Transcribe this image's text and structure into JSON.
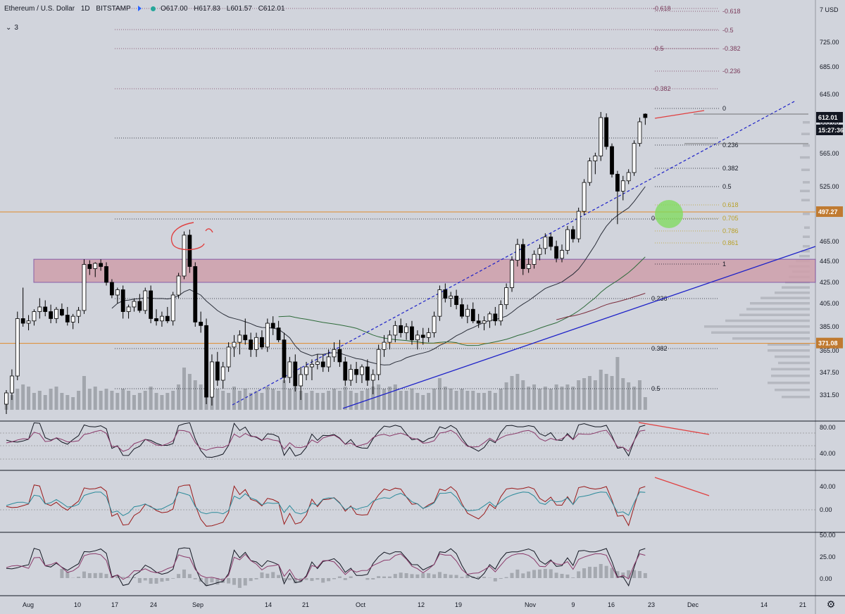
{
  "header": {
    "symbol": "Ethereum / U.S. Dollar",
    "interval": "1D",
    "exchange": "BITSTAMP",
    "open": "O617.00",
    "high": "H617.83",
    "low": "L601.57",
    "close": "C612.01",
    "indicator_count": "3"
  },
  "colors": {
    "background": "#d1d4dc",
    "up_candle": "#ffffff",
    "down_candle": "#000000",
    "trend_blue": "#1e22c8",
    "horizontal_orange": "#e08a2a",
    "resistance_zone": "#cfa0ab",
    "fib": "#7a3a5a",
    "fib_yellow": "#b8a028",
    "divergence_red": "#e04040",
    "price_badge": "#131722",
    "level_badge": "#c07a30",
    "highlight_green": "#7cdc5a"
  },
  "chart_data": {
    "type": "candlestick",
    "title": "Ethereum / U.S. Dollar 1D BITSTAMP",
    "x_ticks": [
      "Aug",
      "10",
      "17",
      "24",
      "Sep",
      "14",
      "21",
      "Oct",
      "12",
      "19",
      "Nov",
      "9",
      "16",
      "23",
      "Dec",
      "14",
      "21"
    ],
    "y_ticks": [
      "7 USD",
      "725.00",
      "685.00",
      "645.00",
      "605.00",
      "565.00",
      "525.00",
      "465.00",
      "445.00",
      "425.00",
      "405.00",
      "385.00",
      "365.00",
      "347.50",
      "331.50"
    ],
    "price_labels": {
      "last": "612.01",
      "countdown": "15:27:36",
      "level_1": "497.27",
      "level_2": "371.08"
    },
    "horizontal_levels": [
      497.27,
      371.08
    ],
    "resistance_zone": {
      "from": 425,
      "to": 447
    },
    "candles_ohlc": [
      [
        325,
        335,
        318,
        333
      ],
      [
        333,
        350,
        328,
        345
      ],
      [
        345,
        398,
        342,
        392
      ],
      [
        392,
        420,
        385,
        388
      ],
      [
        388,
        395,
        382,
        390
      ],
      [
        390,
        400,
        386,
        398
      ],
      [
        398,
        410,
        392,
        402
      ],
      [
        402,
        408,
        394,
        398
      ],
      [
        398,
        404,
        388,
        392
      ],
      [
        392,
        402,
        388,
        400
      ],
      [
        400,
        405,
        394,
        395
      ],
      [
        395,
        402,
        386,
        389
      ],
      [
        389,
        396,
        383,
        394
      ],
      [
        394,
        402,
        388,
        399
      ],
      [
        399,
        447,
        396,
        442
      ],
      [
        442,
        446,
        432,
        438
      ],
      [
        438,
        444,
        430,
        443
      ],
      [
        443,
        447,
        436,
        440
      ],
      [
        440,
        444,
        422,
        425
      ],
      [
        425,
        428,
        410,
        413
      ],
      [
        413,
        420,
        405,
        418
      ],
      [
        418,
        422,
        392,
        398
      ],
      [
        398,
        404,
        392,
        402
      ],
      [
        402,
        410,
        398,
        407
      ],
      [
        407,
        414,
        397,
        399
      ],
      [
        399,
        420,
        396,
        417
      ],
      [
        417,
        422,
        388,
        392
      ],
      [
        392,
        400,
        386,
        390
      ],
      [
        390,
        398,
        385,
        394
      ],
      [
        394,
        402,
        388,
        390
      ],
      [
        390,
        416,
        386,
        413
      ],
      [
        413,
        434,
        410,
        431
      ],
      [
        431,
        476,
        428,
        472
      ],
      [
        472,
        478,
        434,
        440
      ],
      [
        440,
        444,
        385,
        389
      ],
      [
        389,
        398,
        380,
        386
      ],
      [
        386,
        392,
        325,
        330
      ],
      [
        330,
        362,
        324,
        356
      ],
      [
        356,
        364,
        338,
        342
      ],
      [
        342,
        356,
        336,
        352
      ],
      [
        352,
        372,
        348,
        368
      ],
      [
        368,
        378,
        360,
        372
      ],
      [
        372,
        382,
        362,
        378
      ],
      [
        378,
        392,
        370,
        374
      ],
      [
        374,
        380,
        360,
        366
      ],
      [
        366,
        380,
        360,
        376
      ],
      [
        376,
        382,
        366,
        368
      ],
      [
        368,
        392,
        364,
        388
      ],
      [
        388,
        394,
        378,
        384
      ],
      [
        384,
        390,
        372,
        374
      ],
      [
        374,
        380,
        340,
        344
      ],
      [
        344,
        360,
        340,
        356
      ],
      [
        356,
        362,
        334,
        338
      ],
      [
        338,
        352,
        328,
        346
      ],
      [
        346,
        356,
        342,
        352
      ],
      [
        352,
        358,
        342,
        354
      ],
      [
        354,
        362,
        350,
        356
      ],
      [
        356,
        362,
        348,
        352
      ],
      [
        352,
        366,
        348,
        360
      ],
      [
        360,
        372,
        356,
        366
      ],
      [
        366,
        374,
        352,
        356
      ],
      [
        356,
        360,
        338,
        342
      ],
      [
        342,
        354,
        338,
        350
      ],
      [
        350,
        356,
        340,
        346
      ],
      [
        346,
        354,
        340,
        352
      ],
      [
        352,
        358,
        338,
        342
      ],
      [
        342,
        350,
        332,
        346
      ],
      [
        346,
        370,
        342,
        366
      ],
      [
        366,
        378,
        360,
        372
      ],
      [
        372,
        382,
        366,
        378
      ],
      [
        378,
        390,
        372,
        386
      ],
      [
        386,
        392,
        376,
        380
      ],
      [
        380,
        388,
        374,
        385
      ],
      [
        385,
        390,
        370,
        374
      ],
      [
        374,
        382,
        366,
        378
      ],
      [
        378,
        384,
        370,
        376
      ],
      [
        376,
        384,
        372,
        380
      ],
      [
        380,
        398,
        376,
        394
      ],
      [
        394,
        422,
        390,
        418
      ],
      [
        418,
        424,
        406,
        410
      ],
      [
        410,
        416,
        402,
        412
      ],
      [
        412,
        418,
        400,
        404
      ],
      [
        404,
        410,
        392,
        394
      ],
      [
        394,
        404,
        388,
        400
      ],
      [
        400,
        406,
        388,
        390
      ],
      [
        390,
        396,
        384,
        388
      ],
      [
        388,
        394,
        382,
        390
      ],
      [
        390,
        398,
        384,
        396
      ],
      [
        396,
        402,
        386,
        390
      ],
      [
        390,
        408,
        386,
        404
      ],
      [
        404,
        424,
        400,
        420
      ],
      [
        420,
        450,
        416,
        446
      ],
      [
        446,
        468,
        440,
        462
      ],
      [
        462,
        468,
        432,
        438
      ],
      [
        438,
        448,
        434,
        442
      ],
      [
        442,
        456,
        438,
        452
      ],
      [
        452,
        462,
        446,
        458
      ],
      [
        458,
        474,
        452,
        470
      ],
      [
        470,
        474,
        456,
        460
      ],
      [
        460,
        466,
        444,
        448
      ],
      [
        448,
        462,
        444,
        456
      ],
      [
        456,
        482,
        452,
        478
      ],
      [
        478,
        482,
        464,
        468
      ],
      [
        468,
        502,
        464,
        498
      ],
      [
        498,
        534,
        494,
        530
      ],
      [
        530,
        560,
        526,
        556
      ],
      [
        556,
        566,
        540,
        562
      ],
      [
        562,
        620,
        556,
        612
      ],
      [
        612,
        618,
        570,
        574
      ],
      [
        574,
        578,
        536,
        540
      ],
      [
        540,
        544,
        484,
        520
      ],
      [
        520,
        538,
        510,
        532
      ],
      [
        532,
        546,
        528,
        542
      ],
      [
        542,
        582,
        538,
        578
      ],
      [
        578,
        612,
        574,
        606
      ],
      [
        617,
        618,
        602,
        612
      ]
    ],
    "volume_relative": [
      0.3,
      0.35,
      0.5,
      0.6,
      0.55,
      0.4,
      0.45,
      0.35,
      0.5,
      0.55,
      0.4,
      0.35,
      0.3,
      0.45,
      0.8,
      0.5,
      0.55,
      0.45,
      0.5,
      0.45,
      0.4,
      0.5,
      0.45,
      0.35,
      0.4,
      0.45,
      0.55,
      0.4,
      0.35,
      0.4,
      0.45,
      0.6,
      1.0,
      0.85,
      0.7,
      0.6,
      0.95,
      0.7,
      0.5,
      0.45,
      0.4,
      0.55,
      0.45,
      0.5,
      0.4,
      0.45,
      0.4,
      0.55,
      0.5,
      0.45,
      0.7,
      0.5,
      0.55,
      0.45,
      0.4,
      0.45,
      0.4,
      0.4,
      0.45,
      0.5,
      0.45,
      0.55,
      0.45,
      0.4,
      0.45,
      0.5,
      0.55,
      0.6,
      0.5,
      0.55,
      0.6,
      0.45,
      0.45,
      0.5,
      0.4,
      0.35,
      0.4,
      0.5,
      0.75,
      0.55,
      0.5,
      0.45,
      0.5,
      0.45,
      0.45,
      0.4,
      0.4,
      0.45,
      0.4,
      0.5,
      0.65,
      0.8,
      0.85,
      0.7,
      0.55,
      0.6,
      0.5,
      0.55,
      0.5,
      0.6,
      0.55,
      0.6,
      0.55,
      0.7,
      0.75,
      0.8,
      0.7,
      0.95,
      0.85,
      0.8,
      1.25,
      0.75,
      0.65,
      0.55,
      0.7,
      0.3
    ],
    "fib_upper_labels": [
      "-0.618",
      "-0.5",
      "-0.382",
      "-0.236",
      "0",
      "0.236",
      "0.382",
      "0.5",
      "0.618",
      "0.705",
      "0.786",
      "0.861",
      "1"
    ],
    "fib_lower_labels": [
      "-0.618",
      "-0.5",
      "-0.382",
      "0",
      "0.236",
      "0.382",
      "0.5"
    ],
    "rsi_ticks": [
      "80.00",
      "40.00"
    ],
    "stoch_ticks": [
      "40.00",
      "0.00"
    ],
    "macd_ticks": [
      "50.00",
      "25.00",
      "0.00"
    ]
  }
}
